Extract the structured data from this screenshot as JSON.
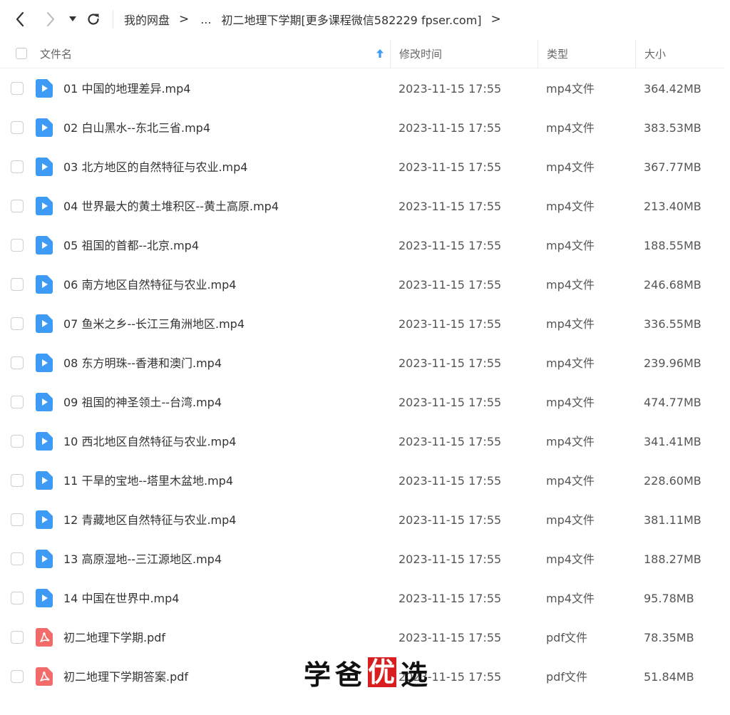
{
  "nav": {
    "back_icon": "chevron-left-icon",
    "forward_icon": "chevron-right-icon",
    "history_icon": "caret-down-icon",
    "refresh_icon": "refresh-icon"
  },
  "breadcrumb": {
    "root": "我的网盘",
    "separator": ">",
    "ellipsis": "...",
    "current": "初二地理下学期[更多课程微信582229 fpser.com]",
    "trailing": ">"
  },
  "table": {
    "columns": {
      "name": "文件名",
      "time": "修改时间",
      "type": "类型",
      "size": "大小"
    },
    "sort_column": "name",
    "sort_direction": "asc",
    "rows": [
      {
        "name": "01 中国的地理差异.mp4",
        "time": "2023-11-15 17:55",
        "type": "mp4文件",
        "size": "364.42MB",
        "kind": "video"
      },
      {
        "name": "02 白山黑水--东北三省.mp4",
        "time": "2023-11-15 17:55",
        "type": "mp4文件",
        "size": "383.53MB",
        "kind": "video"
      },
      {
        "name": "03 北方地区的自然特征与农业.mp4",
        "time": "2023-11-15 17:55",
        "type": "mp4文件",
        "size": "367.77MB",
        "kind": "video"
      },
      {
        "name": "04 世界最大的黄土堆积区--黄土高原.mp4",
        "time": "2023-11-15 17:55",
        "type": "mp4文件",
        "size": "213.40MB",
        "kind": "video"
      },
      {
        "name": "05 祖国的首都--北京.mp4",
        "time": "2023-11-15 17:55",
        "type": "mp4文件",
        "size": "188.55MB",
        "kind": "video"
      },
      {
        "name": "06 南方地区自然特征与农业.mp4",
        "time": "2023-11-15 17:55",
        "type": "mp4文件",
        "size": "246.68MB",
        "kind": "video"
      },
      {
        "name": "07 鱼米之乡--长江三角洲地区.mp4",
        "time": "2023-11-15 17:55",
        "type": "mp4文件",
        "size": "336.55MB",
        "kind": "video"
      },
      {
        "name": "08 东方明珠--香港和澳门.mp4",
        "time": "2023-11-15 17:55",
        "type": "mp4文件",
        "size": "239.96MB",
        "kind": "video"
      },
      {
        "name": "09 祖国的神圣领土--台湾.mp4",
        "time": "2023-11-15 17:55",
        "type": "mp4文件",
        "size": "474.77MB",
        "kind": "video"
      },
      {
        "name": "10 西北地区自然特征与农业.mp4",
        "time": "2023-11-15 17:55",
        "type": "mp4文件",
        "size": "341.41MB",
        "kind": "video"
      },
      {
        "name": "11 干旱的宝地--塔里木盆地.mp4",
        "time": "2023-11-15 17:55",
        "type": "mp4文件",
        "size": "228.60MB",
        "kind": "video"
      },
      {
        "name": "12 青藏地区自然特征与农业.mp4",
        "time": "2023-11-15 17:55",
        "type": "mp4文件",
        "size": "381.11MB",
        "kind": "video"
      },
      {
        "name": "13 高原湿地--三江源地区.mp4",
        "time": "2023-11-15 17:55",
        "type": "mp4文件",
        "size": "188.27MB",
        "kind": "video"
      },
      {
        "name": "14 中国在世界中.mp4",
        "time": "2023-11-15 17:55",
        "type": "mp4文件",
        "size": "95.78MB",
        "kind": "video"
      },
      {
        "name": "初二地理下学期.pdf",
        "time": "2023-11-15 17:55",
        "type": "pdf文件",
        "size": "78.35MB",
        "kind": "pdf"
      },
      {
        "name": "初二地理下学期答案.pdf",
        "time": "2023-11-15 17:55",
        "type": "pdf文件",
        "size": "51.84MB",
        "kind": "pdf"
      }
    ]
  },
  "watermark": {
    "chars": [
      "学",
      "爸",
      "优",
      "选"
    ],
    "highlight_index": 2
  },
  "colors": {
    "video_icon": "#3d9bf5",
    "pdf_icon": "#f26b6b",
    "sort_arrow": "#3d9bf5",
    "watermark_highlight": "#d81e1e"
  }
}
